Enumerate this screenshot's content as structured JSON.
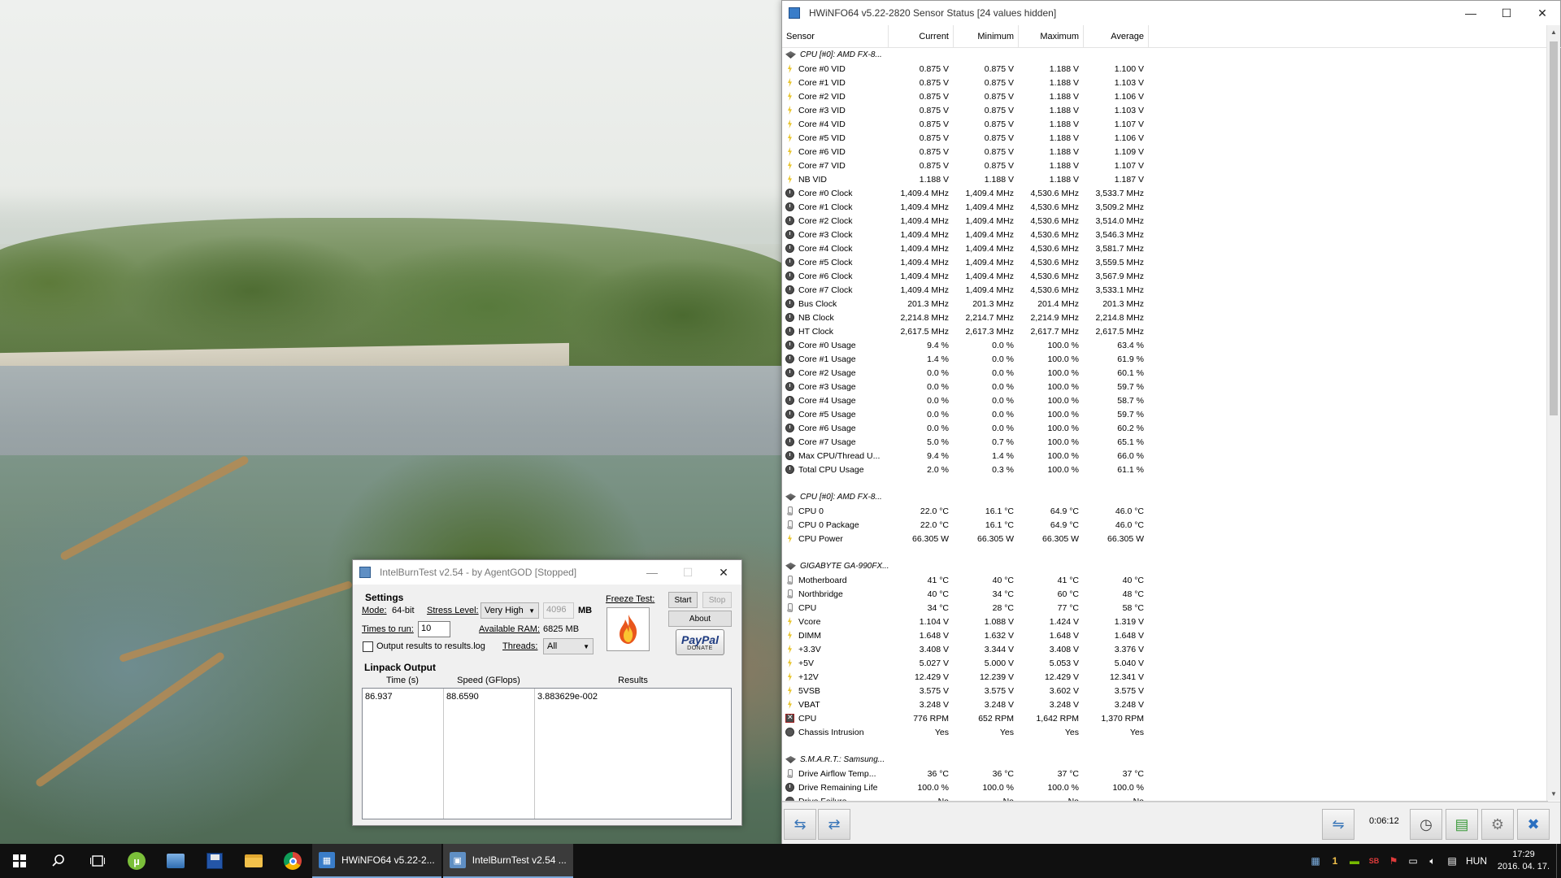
{
  "hwinfo": {
    "title": "HWiNFO64 v5.22-2820 Sensor Status [24 values hidden]",
    "columns": [
      "Sensor",
      "Current",
      "Minimum",
      "Maximum",
      "Average"
    ],
    "timer": "0:06:12",
    "rows": [
      {
        "type": "group",
        "icon": "chip",
        "name": "CPU [#0]: AMD FX-8...",
        "cur": "",
        "min": "",
        "max": "",
        "avg": ""
      },
      {
        "type": "row",
        "icon": "volt",
        "name": "Core #0 VID",
        "cur": "0.875 V",
        "min": "0.875 V",
        "max": "1.188 V",
        "avg": "1.100 V"
      },
      {
        "type": "row",
        "icon": "volt",
        "name": "Core #1 VID",
        "cur": "0.875 V",
        "min": "0.875 V",
        "max": "1.188 V",
        "avg": "1.103 V"
      },
      {
        "type": "row",
        "icon": "volt",
        "name": "Core #2 VID",
        "cur": "0.875 V",
        "min": "0.875 V",
        "max": "1.188 V",
        "avg": "1.106 V"
      },
      {
        "type": "row",
        "icon": "volt",
        "name": "Core #3 VID",
        "cur": "0.875 V",
        "min": "0.875 V",
        "max": "1.188 V",
        "avg": "1.103 V"
      },
      {
        "type": "row",
        "icon": "volt",
        "name": "Core #4 VID",
        "cur": "0.875 V",
        "min": "0.875 V",
        "max": "1.188 V",
        "avg": "1.107 V"
      },
      {
        "type": "row",
        "icon": "volt",
        "name": "Core #5 VID",
        "cur": "0.875 V",
        "min": "0.875 V",
        "max": "1.188 V",
        "avg": "1.106 V"
      },
      {
        "type": "row",
        "icon": "volt",
        "name": "Core #6 VID",
        "cur": "0.875 V",
        "min": "0.875 V",
        "max": "1.188 V",
        "avg": "1.109 V"
      },
      {
        "type": "row",
        "icon": "volt",
        "name": "Core #7 VID",
        "cur": "0.875 V",
        "min": "0.875 V",
        "max": "1.188 V",
        "avg": "1.107 V"
      },
      {
        "type": "row",
        "icon": "volt",
        "name": "NB VID",
        "cur": "1.188 V",
        "min": "1.188 V",
        "max": "1.188 V",
        "avg": "1.187 V"
      },
      {
        "type": "row",
        "icon": "clock",
        "name": "Core #0 Clock",
        "cur": "1,409.4 MHz",
        "min": "1,409.4 MHz",
        "max": "4,530.6 MHz",
        "avg": "3,533.7 MHz"
      },
      {
        "type": "row",
        "icon": "clock",
        "name": "Core #1 Clock",
        "cur": "1,409.4 MHz",
        "min": "1,409.4 MHz",
        "max": "4,530.6 MHz",
        "avg": "3,509.2 MHz"
      },
      {
        "type": "row",
        "icon": "clock",
        "name": "Core #2 Clock",
        "cur": "1,409.4 MHz",
        "min": "1,409.4 MHz",
        "max": "4,530.6 MHz",
        "avg": "3,514.0 MHz"
      },
      {
        "type": "row",
        "icon": "clock",
        "name": "Core #3 Clock",
        "cur": "1,409.4 MHz",
        "min": "1,409.4 MHz",
        "max": "4,530.6 MHz",
        "avg": "3,546.3 MHz"
      },
      {
        "type": "row",
        "icon": "clock",
        "name": "Core #4 Clock",
        "cur": "1,409.4 MHz",
        "min": "1,409.4 MHz",
        "max": "4,530.6 MHz",
        "avg": "3,581.7 MHz"
      },
      {
        "type": "row",
        "icon": "clock",
        "name": "Core #5 Clock",
        "cur": "1,409.4 MHz",
        "min": "1,409.4 MHz",
        "max": "4,530.6 MHz",
        "avg": "3,559.5 MHz"
      },
      {
        "type": "row",
        "icon": "clock",
        "name": "Core #6 Clock",
        "cur": "1,409.4 MHz",
        "min": "1,409.4 MHz",
        "max": "4,530.6 MHz",
        "avg": "3,567.9 MHz"
      },
      {
        "type": "row",
        "icon": "clock",
        "name": "Core #7 Clock",
        "cur": "1,409.4 MHz",
        "min": "1,409.4 MHz",
        "max": "4,530.6 MHz",
        "avg": "3,533.1 MHz"
      },
      {
        "type": "row",
        "icon": "clock",
        "name": "Bus Clock",
        "cur": "201.3 MHz",
        "min": "201.3 MHz",
        "max": "201.4 MHz",
        "avg": "201.3 MHz"
      },
      {
        "type": "row",
        "icon": "clock",
        "name": "NB Clock",
        "cur": "2,214.8 MHz",
        "min": "2,214.7 MHz",
        "max": "2,214.9 MHz",
        "avg": "2,214.8 MHz"
      },
      {
        "type": "row",
        "icon": "clock",
        "name": "HT Clock",
        "cur": "2,617.5 MHz",
        "min": "2,617.3 MHz",
        "max": "2,617.7 MHz",
        "avg": "2,617.5 MHz"
      },
      {
        "type": "row",
        "icon": "clock",
        "name": "Core #0 Usage",
        "cur": "9.4 %",
        "min": "0.0 %",
        "max": "100.0 %",
        "avg": "63.4 %"
      },
      {
        "type": "row",
        "icon": "clock",
        "name": "Core #1 Usage",
        "cur": "1.4 %",
        "min": "0.0 %",
        "max": "100.0 %",
        "avg": "61.9 %"
      },
      {
        "type": "row",
        "icon": "clock",
        "name": "Core #2 Usage",
        "cur": "0.0 %",
        "min": "0.0 %",
        "max": "100.0 %",
        "avg": "60.1 %"
      },
      {
        "type": "row",
        "icon": "clock",
        "name": "Core #3 Usage",
        "cur": "0.0 %",
        "min": "0.0 %",
        "max": "100.0 %",
        "avg": "59.7 %"
      },
      {
        "type": "row",
        "icon": "clock",
        "name": "Core #4 Usage",
        "cur": "0.0 %",
        "min": "0.0 %",
        "max": "100.0 %",
        "avg": "58.7 %"
      },
      {
        "type": "row",
        "icon": "clock",
        "name": "Core #5 Usage",
        "cur": "0.0 %",
        "min": "0.0 %",
        "max": "100.0 %",
        "avg": "59.7 %"
      },
      {
        "type": "row",
        "icon": "clock",
        "name": "Core #6 Usage",
        "cur": "0.0 %",
        "min": "0.0 %",
        "max": "100.0 %",
        "avg": "60.2 %"
      },
      {
        "type": "row",
        "icon": "clock",
        "name": "Core #7 Usage",
        "cur": "5.0 %",
        "min": "0.7 %",
        "max": "100.0 %",
        "avg": "65.1 %"
      },
      {
        "type": "row",
        "icon": "clock",
        "name": "Max CPU/Thread U...",
        "cur": "9.4 %",
        "min": "1.4 %",
        "max": "100.0 %",
        "avg": "66.0 %"
      },
      {
        "type": "row",
        "icon": "clock",
        "name": "Total CPU Usage",
        "cur": "2.0 %",
        "min": "0.3 %",
        "max": "100.0 %",
        "avg": "61.1 %"
      },
      {
        "type": "spacer"
      },
      {
        "type": "group",
        "icon": "chip",
        "name": "CPU [#0]: AMD FX-8...",
        "cur": "",
        "min": "",
        "max": "",
        "avg": ""
      },
      {
        "type": "row",
        "icon": "therm",
        "name": "CPU 0",
        "cur": "22.0 °C",
        "min": "16.1 °C",
        "max": "64.9 °C",
        "avg": "46.0 °C"
      },
      {
        "type": "row",
        "icon": "therm",
        "name": "CPU 0 Package",
        "cur": "22.0 °C",
        "min": "16.1 °C",
        "max": "64.9 °C",
        "avg": "46.0 °C"
      },
      {
        "type": "row",
        "icon": "volt",
        "name": "CPU Power",
        "cur": "66.305 W",
        "min": "66.305 W",
        "max": "66.305 W",
        "avg": "66.305 W"
      },
      {
        "type": "spacer"
      },
      {
        "type": "group",
        "icon": "chip",
        "name": "GIGABYTE GA-990FX...",
        "cur": "",
        "min": "",
        "max": "",
        "avg": ""
      },
      {
        "type": "row",
        "icon": "therm",
        "name": "Motherboard",
        "cur": "41 °C",
        "min": "40 °C",
        "max": "41 °C",
        "avg": "40 °C"
      },
      {
        "type": "row",
        "icon": "therm",
        "name": "Northbridge",
        "cur": "40 °C",
        "min": "34 °C",
        "max": "60 °C",
        "avg": "48 °C"
      },
      {
        "type": "row",
        "icon": "therm",
        "name": "CPU",
        "cur": "34 °C",
        "min": "28 °C",
        "max": "77 °C",
        "avg": "58 °C"
      },
      {
        "type": "row",
        "icon": "volt",
        "name": "Vcore",
        "cur": "1.104 V",
        "min": "1.088 V",
        "max": "1.424 V",
        "avg": "1.319 V"
      },
      {
        "type": "row",
        "icon": "volt",
        "name": "DIMM",
        "cur": "1.648 V",
        "min": "1.632 V",
        "max": "1.648 V",
        "avg": "1.648 V"
      },
      {
        "type": "row",
        "icon": "volt",
        "name": "+3.3V",
        "cur": "3.408 V",
        "min": "3.344 V",
        "max": "3.408 V",
        "avg": "3.376 V"
      },
      {
        "type": "row",
        "icon": "volt",
        "name": "+5V",
        "cur": "5.027 V",
        "min": "5.000 V",
        "max": "5.053 V",
        "avg": "5.040 V"
      },
      {
        "type": "row",
        "icon": "volt",
        "name": "+12V",
        "cur": "12.429 V",
        "min": "12.239 V",
        "max": "12.429 V",
        "avg": "12.341 V"
      },
      {
        "type": "row",
        "icon": "volt",
        "name": "5VSB",
        "cur": "3.575 V",
        "min": "3.575 V",
        "max": "3.602 V",
        "avg": "3.575 V"
      },
      {
        "type": "row",
        "icon": "volt",
        "name": "VBAT",
        "cur": "3.248 V",
        "min": "3.248 V",
        "max": "3.248 V",
        "avg": "3.248 V"
      },
      {
        "type": "row",
        "icon": "fan",
        "name": "CPU",
        "cur": "776 RPM",
        "min": "652 RPM",
        "max": "1,642 RPM",
        "avg": "1,370 RPM"
      },
      {
        "type": "row",
        "icon": "yes",
        "name": "Chassis Intrusion",
        "cur": "Yes",
        "min": "Yes",
        "max": "Yes",
        "avg": "Yes"
      },
      {
        "type": "spacer"
      },
      {
        "type": "group",
        "icon": "chip",
        "name": "S.M.A.R.T.: Samsung...",
        "cur": "",
        "min": "",
        "max": "",
        "avg": ""
      },
      {
        "type": "row",
        "icon": "therm",
        "name": "Drive Airflow Temp...",
        "cur": "36 °C",
        "min": "36 °C",
        "max": "37 °C",
        "avg": "37 °C"
      },
      {
        "type": "row",
        "icon": "clock",
        "name": "Drive Remaining Life",
        "cur": "100.0 %",
        "min": "100.0 %",
        "max": "100.0 %",
        "avg": "100.0 %"
      },
      {
        "type": "row",
        "icon": "yes",
        "name": "Drive Failure",
        "cur": "No",
        "min": "No",
        "max": "No",
        "avg": "No"
      }
    ]
  },
  "ibt": {
    "title": "IntelBurnTest v2.54 - by AgentGOD [Stopped]",
    "settings_label": "Settings",
    "mode_label": "Mode:",
    "mode_value": "64-bit",
    "stress_label": "Stress Level:",
    "stress_value": "Very High",
    "mem_value": "4096",
    "mem_unit": "MB",
    "times_label": "Times to run:",
    "times_value": "10",
    "ram_label": "Available RAM:",
    "ram_value": "6825 MB",
    "threads_label": "Threads:",
    "threads_value": "All",
    "output_log_label": "Output results to results.log",
    "freeze_label": "Freeze Test:",
    "start_label": "Start",
    "stop_label": "Stop",
    "about_label": "About",
    "paypal_label": "PayPal",
    "donate_label": "DONATE",
    "linpack_label": "Linpack Output",
    "col_time": "Time (s)",
    "col_speed": "Speed (GFlops)",
    "col_results": "Results",
    "row_time": "86.937",
    "row_speed": "88.6590",
    "row_result": "3.883629e-002"
  },
  "taskbar": {
    "apps": [
      {
        "label": "HWiNFO64 v5.22-2...",
        "active": false
      },
      {
        "label": "IntelBurnTest v2.54 ...",
        "active": true
      }
    ],
    "tray_count": "1",
    "language": "HUN",
    "time": "17:29",
    "date": "2016. 04. 17."
  }
}
